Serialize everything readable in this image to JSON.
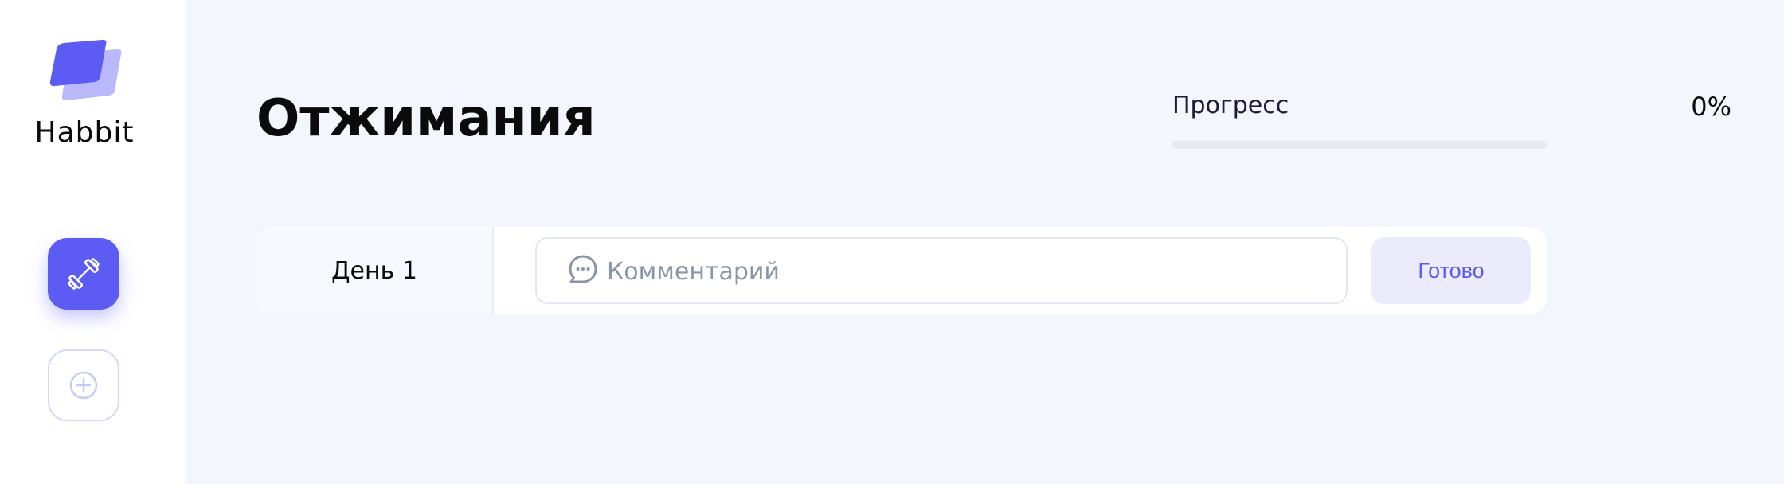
{
  "brand": {
    "name": "Habbit",
    "logo_icon": "habbit-logo-icon",
    "accent_color": "#5C5CF5",
    "accent_light_color": "#B9B8FB"
  },
  "sidebar": {
    "items": [
      {
        "icon": "dumbbell-icon",
        "active": true
      },
      {
        "icon": "plus-circle-icon",
        "active": false
      }
    ]
  },
  "habit": {
    "title": "Отжимания"
  },
  "progress": {
    "label": "Прогресс",
    "value_text": "0%",
    "value": 0
  },
  "days": [
    {
      "label": "День 1",
      "comment_icon": "comment-icon",
      "comment_value": "",
      "comment_placeholder": "Комментарий",
      "done_label": "Готово"
    }
  ]
}
